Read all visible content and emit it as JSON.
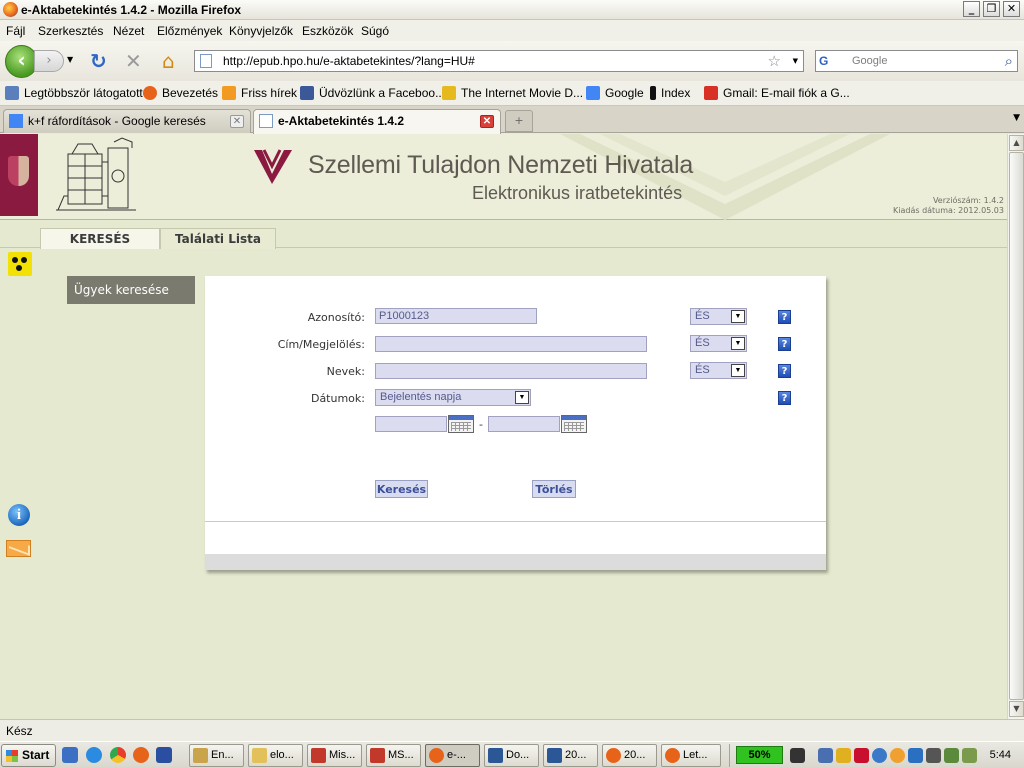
{
  "window": {
    "title": "e-Aktabetekintés 1.4.2 - Mozilla Firefox",
    "min_label": "_",
    "max_label": "❐",
    "close_label": "✕"
  },
  "menu": [
    "Fájl",
    "Szerkesztés",
    "Nézet",
    "Előzmények",
    "Könyvjelzők",
    "Eszközök",
    "Súgó"
  ],
  "nav": {
    "url": "http://epub.hpo.hu/e-aktabetekintes/?lang=HU#",
    "search_placeholder": "Google"
  },
  "bookmarks": [
    {
      "label": "Legtöbbször látogatott",
      "icon": "page-icon",
      "color": "#5b7fbd"
    },
    {
      "label": "Bevezetés",
      "icon": "firefox-icon",
      "color": "#e8631a"
    },
    {
      "label": "Friss hírek",
      "icon": "rss-icon",
      "color": "#f29a22"
    },
    {
      "label": "Üdvözlünk a Faceboo...",
      "icon": "facebook-icon",
      "color": "#3b5998"
    },
    {
      "label": "The Internet Movie D...",
      "icon": "imdb-icon",
      "color": "#e6b91e"
    },
    {
      "label": "Google",
      "icon": "google-icon",
      "color": "#4285f4"
    },
    {
      "label": "Index",
      "icon": "index-icon",
      "color": "#111111"
    },
    {
      "label": "Gmail: E-mail fiók a G...",
      "icon": "gmail-icon",
      "color": "#d93025"
    }
  ],
  "tabs": [
    {
      "label": "k+f ráfordítások - Google keresés",
      "active": false
    },
    {
      "label": "e-Aktabetekintés 1.4.2",
      "active": true
    }
  ],
  "header": {
    "office_name": "Szellemi Tulajdon Nemzeti Hivatala",
    "subtitle": "Elektronikus iratbetekintés",
    "version_line": "Verziószám: 1.4.2",
    "release_line": "Kiadás dátuma: 2012.05.03",
    "brand_color": "#8a1a40"
  },
  "app_tabs": {
    "search": "KERESÉS",
    "results": "Találati Lista"
  },
  "side_menu": {
    "case_search": "Ügyek keresése"
  },
  "form": {
    "id_label": "Azonosító:",
    "id_value": "P1000123",
    "title_label": "Cím/Megjelölés:",
    "title_value": "",
    "names_label": "Nevek:",
    "names_value": "",
    "dates_label": "Dátumok:",
    "date_type": "Bejelentés napja",
    "operator": "ÉS",
    "date_from": "",
    "date_to": "",
    "date_separator": "-",
    "help_label": "?",
    "search_button": "Keresés",
    "clear_button": "Törlés"
  },
  "status": {
    "text": "Kész"
  },
  "taskbar": {
    "start": "Start",
    "tasks": [
      {
        "label": "En...",
        "color": "#c9a44a"
      },
      {
        "label": "elo...",
        "color": "#e3c15a"
      },
      {
        "label": "Mis...",
        "color": "#c2392b"
      },
      {
        "label": "MS...",
        "color": "#c2392b"
      },
      {
        "label": "e-...",
        "color": "#e8631a",
        "active": true
      },
      {
        "label": "Do...",
        "color": "#2b5797"
      },
      {
        "label": "20...",
        "color": "#2b5797"
      },
      {
        "label": "20...",
        "color": "#e8631a"
      },
      {
        "label": "Let...",
        "color": "#e8631a"
      }
    ],
    "battery": "50%",
    "clock": "5:44"
  }
}
